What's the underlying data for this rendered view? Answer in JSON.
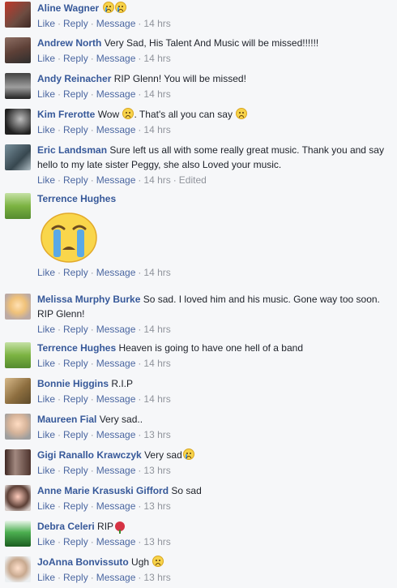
{
  "actions": {
    "like": "Like",
    "reply": "Reply",
    "message": "Message",
    "edited": "Edited"
  },
  "comments": [
    {
      "author": "Aline Wagner",
      "text": "",
      "emoji": [
        "sad-icon",
        "sad-icon"
      ],
      "time": "14 hrs"
    },
    {
      "author": "Andrew North",
      "text": "Very Sad, His Talent And Music will be missed!!!!!!",
      "time": "14 hrs"
    },
    {
      "author": "Andy Reinacher",
      "text": "RIP Glenn! You will be missed!",
      "time": "14 hrs"
    },
    {
      "author": "Kim Frerotte",
      "text_a": "Wow",
      "text_b": ". That's all you can say",
      "time": "14 hrs"
    },
    {
      "author": "Eric Landsman",
      "text": "Sure left us all with some really great music. Thank you and say hello to my late sister Peggy, she also Loved your music.",
      "time": "14 hrs"
    },
    {
      "author": "Terrence Hughes",
      "text": "",
      "sticker": "crying-face-sticker",
      "time": "14 hrs"
    },
    {
      "author": "Melissa Murphy Burke",
      "text": "So sad. I loved him and his music. Gone way too soon. RIP Glenn!",
      "time": "14 hrs"
    },
    {
      "author": "Terrence Hughes",
      "text": "Heaven is going to have one hell of a band",
      "time": "14 hrs"
    },
    {
      "author": "Bonnie Higgins",
      "text": "R.I.P",
      "time": "14 hrs"
    },
    {
      "author": "Maureen Fial",
      "text": "Very sad..",
      "time": "13 hrs"
    },
    {
      "author": "Gigi Ranallo Krawczyk",
      "text": "Very sad",
      "emoji": [
        "crying-icon"
      ],
      "time": "13 hrs"
    },
    {
      "author": "Anne Marie Krasuski Gifford",
      "text": "So sad",
      "time": "13 hrs"
    },
    {
      "author": "Debra Celeri",
      "text": "RIP",
      "emoji": [
        "rose-icon"
      ],
      "time": "13 hrs"
    },
    {
      "author": "JoAnna Bonvissuto",
      "text": "Ugh",
      "emoji": [
        "sad-icon"
      ],
      "time": "13 hrs"
    }
  ],
  "colors": {
    "author": "#365899",
    "action_link": "#4b67a1",
    "meta": "#90949c",
    "background": "#f6f7f9"
  }
}
